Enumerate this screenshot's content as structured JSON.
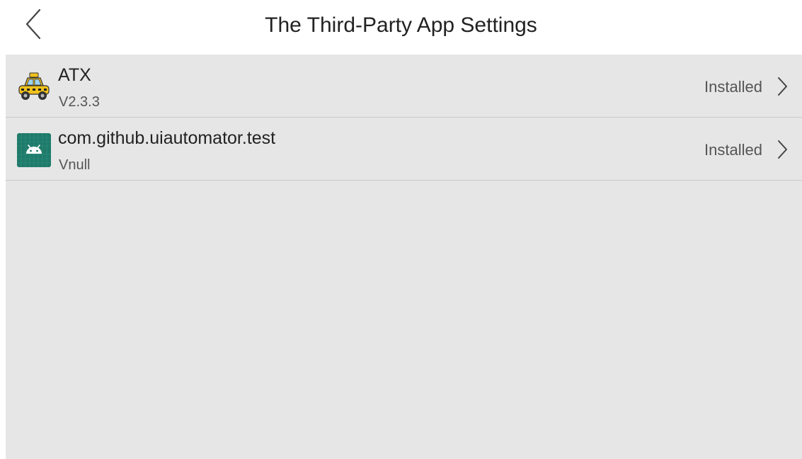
{
  "header": {
    "title": "The Third-Party App Settings",
    "back_icon": "chevron-left-icon"
  },
  "apps": [
    {
      "name": "ATX",
      "version": "V2.3.3",
      "status": "Installed",
      "icon": "taxi-car-icon"
    },
    {
      "name": "com.github.uiautomator.test",
      "version": "Vnull",
      "status": "Installed",
      "icon": "android-app-icon"
    }
  ],
  "colors": {
    "list_background": "#e6e6e6",
    "android_icon_green": "#1f7a6a",
    "taxi_yellow": "#f2c21b"
  }
}
